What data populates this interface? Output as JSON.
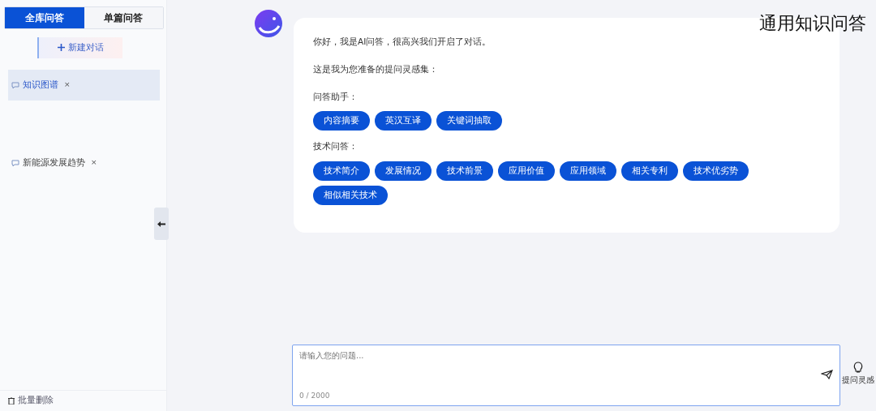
{
  "sidebar": {
    "tabs": [
      {
        "label": "全库问答",
        "selected": true
      },
      {
        "label": "单篇问答",
        "selected": false
      }
    ],
    "new_chat": {
      "label": "新建对话"
    },
    "conversations": [
      {
        "title": "知识图谱",
        "close": "×",
        "selected": true
      },
      {
        "title": "新能源发展趋势",
        "close": "×",
        "selected": false
      }
    ],
    "batch_delete": "批量删除"
  },
  "header": {
    "title": "通用知识问答"
  },
  "message": {
    "greeting": "你好，我是AI问答，很高兴我们开启了对话。",
    "intro": "这是我为您准备的提问灵感集：",
    "groups": [
      {
        "label": "问答助手：",
        "chips": [
          "内容摘要",
          "英汉互译",
          "关键词抽取"
        ]
      },
      {
        "label": "技术问答：",
        "chips": [
          "技术简介",
          "发展情况",
          "技术前景",
          "应用价值",
          "应用领域",
          "相关专利",
          "技术优劣势",
          "相似相关技术"
        ]
      }
    ]
  },
  "input": {
    "placeholder": "请输入您的问题...",
    "counter": "0 / 2000"
  },
  "hint_button": {
    "label": "提问灵感"
  }
}
